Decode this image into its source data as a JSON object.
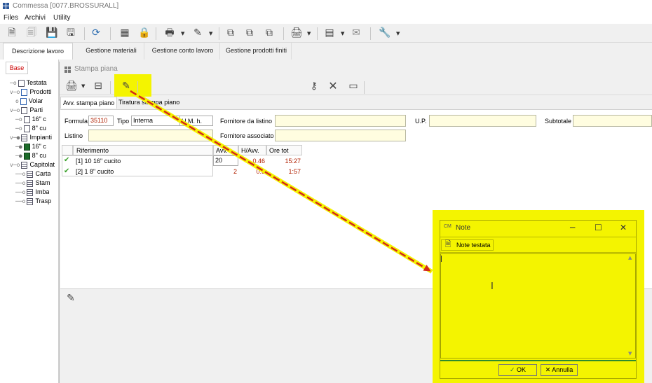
{
  "window": {
    "title": "Commessa   [0077.BROSSURALL]"
  },
  "menu": [
    "Files",
    "Archivi",
    "Utility"
  ],
  "toolbar_icons": [
    "new-doc-icon",
    "copy-doc-icon",
    "save-icon",
    "save-all-icon",
    "refresh-icon",
    "calculator-icon",
    "lock-icon",
    "print-icon",
    "edit-icon",
    "window-copy-icon",
    "window-copy2-icon",
    "window-import-icon",
    "printer-icon",
    "stamp-icon",
    "mail-icon",
    "wrench-icon"
  ],
  "main_tabs": [
    "Descrizione lavoro",
    "Gestione materiali",
    "Gestione conto lavoro",
    "Gestione prodotti finiti"
  ],
  "left_tab": "Base",
  "tree": [
    {
      "label": "Testata",
      "indent": 0
    },
    {
      "label": "Prodotti",
      "indent": 0
    },
    {
      "label": "Volar",
      "indent": 1
    },
    {
      "label": "Parti",
      "indent": 0
    },
    {
      "label": "16\" c",
      "indent": 1
    },
    {
      "label": "8\" cu",
      "indent": 1
    },
    {
      "label": "Impianti",
      "indent": 0
    },
    {
      "label": "16\" c",
      "indent": 1
    },
    {
      "label": "8\" cu",
      "indent": 1
    },
    {
      "label": "Capitolat",
      "indent": 0
    },
    {
      "label": "Carta",
      "indent": 1
    },
    {
      "label": "Stam",
      "indent": 1
    },
    {
      "label": "Imba",
      "indent": 1
    },
    {
      "label": "Trasp",
      "indent": 1
    }
  ],
  "subwindow": {
    "title": "Stampa piana",
    "tabs": [
      "Avv. stampa piano",
      "Tiratura stampa piano"
    ],
    "form": {
      "formula_label": "Formula",
      "formula_value": "35110",
      "tipo_label": "Tipo",
      "tipo_value": "Interna",
      "um_label": "U.M. h.",
      "fornitore_listino_label": "Fornitore da listino",
      "up_label": "U.P.",
      "subtotale_label": "Subtotale",
      "listino_label": "Listino",
      "fornitore_associato_label": "Fornitore associato"
    },
    "grid": {
      "headers": [
        "Riferimento",
        "Avv.",
        "H/Avv.",
        "Ore tot"
      ],
      "rows": [
        {
          "ref": "[1] 10 16\" cucito",
          "avv": "20",
          "h_avv": "0.46",
          "ore_tot": "15:27"
        },
        {
          "ref": "[2] 1 8\" cucito",
          "avv": "2",
          "h_avv": "0.5",
          "ore_tot": "1:57"
        }
      ]
    }
  },
  "note_dialog": {
    "title": "Note",
    "note_testata_label": "Note testata",
    "ok_label": "OK",
    "cancel_label": "Annulla"
  },
  "colors": {
    "highlight": "#f4f400",
    "arrow": "#d42a1a",
    "accent_red": "#c00000"
  }
}
